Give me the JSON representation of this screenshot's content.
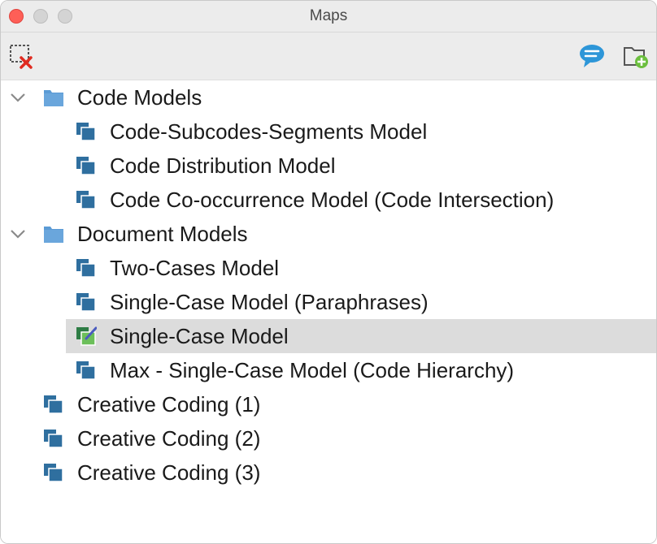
{
  "window": {
    "title": "Maps"
  },
  "toolbar": {
    "left_icon": "close-map-icon",
    "right_icons": [
      "comment-icon",
      "new-folder-icon"
    ]
  },
  "tree": {
    "folders": [
      {
        "label": "Code Models",
        "expanded": true,
        "items": [
          {
            "label": "Code-Subcodes-Segments Model"
          },
          {
            "label": "Code Distribution Model"
          },
          {
            "label": "Code Co-occurrence Model (Code Intersection)"
          }
        ]
      },
      {
        "label": "Document Models",
        "expanded": true,
        "items": [
          {
            "label": "Two-Cases Model"
          },
          {
            "label": "Single-Case Model (Paraphrases)"
          },
          {
            "label": "Single-Case Model",
            "selected": true,
            "editable": true
          },
          {
            "label": "Max - Single-Case Model (Code Hierarchy)"
          }
        ]
      }
    ],
    "root_items": [
      {
        "label": "Creative Coding (1)"
      },
      {
        "label": "Creative Coding (2)"
      },
      {
        "label": "Creative Coding (3)"
      }
    ]
  },
  "colors": {
    "folder": "#5b9bd5",
    "map_icon": "#2f6f9f",
    "selected_row": "#dcdcdc",
    "edit_icon": "#6cbf5a"
  }
}
